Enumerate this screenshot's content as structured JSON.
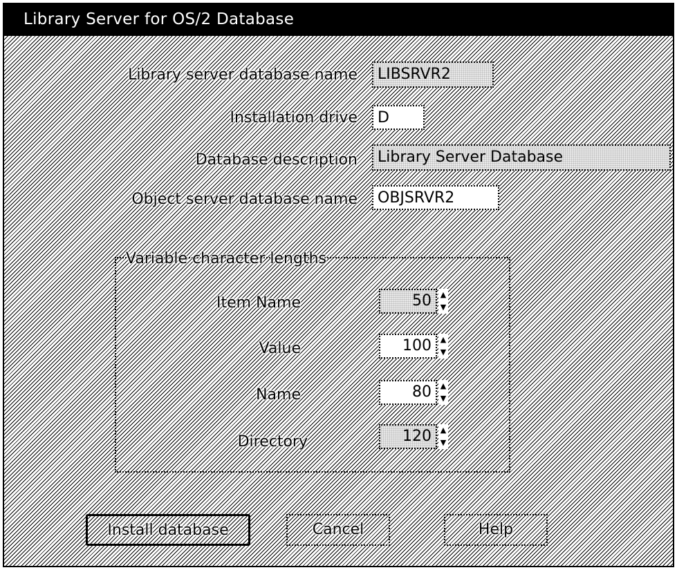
{
  "window": {
    "title": "Library Server for OS/2 Database"
  },
  "form": {
    "library_db_name": {
      "label": "Library server database name",
      "value": "LIBSRVR2"
    },
    "install_drive": {
      "label": "Installation drive",
      "value": "D"
    },
    "db_description": {
      "label": "Database description",
      "value": "Library Server Database"
    },
    "object_db_name": {
      "label": "Object server database name",
      "value": "OBJSRVR2"
    }
  },
  "lengths": {
    "group_label": "Variable character lengths",
    "item_name": {
      "label": "Item Name",
      "value": "50"
    },
    "value": {
      "label": "Value",
      "value": "100"
    },
    "name": {
      "label": "Name",
      "value": "80"
    },
    "directory": {
      "label": "Directory",
      "value": "120"
    }
  },
  "buttons": {
    "install": "Install database",
    "cancel": "Cancel",
    "help": "Help"
  },
  "icons": {
    "spin_up": "arrow-up-icon",
    "spin_down": "arrow-down-icon"
  }
}
